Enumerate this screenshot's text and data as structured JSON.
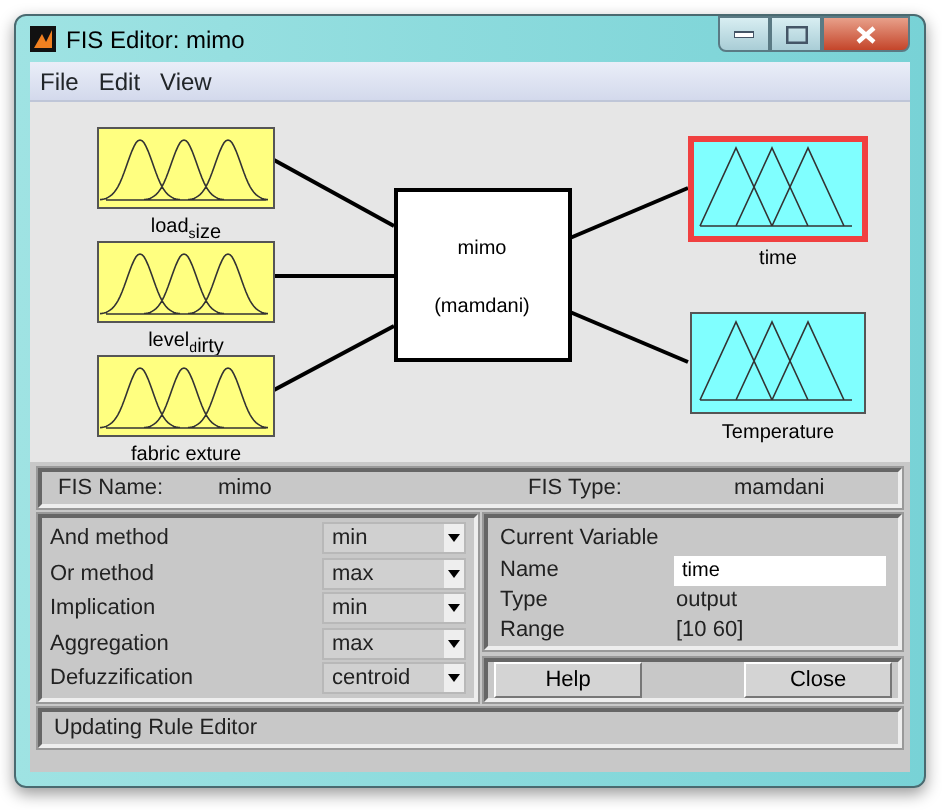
{
  "window": {
    "title": "FIS Editor: mimo"
  },
  "menu": [
    "File",
    "Edit",
    "View"
  ],
  "inputs": [
    {
      "label": "load$_{s}$ize",
      "selected": false
    },
    {
      "label": "level$_{d}$irty",
      "selected": false
    },
    {
      "label": "fabric exture",
      "selected": false
    }
  ],
  "system": {
    "name": "mimo",
    "type": "(mamdani)"
  },
  "outputs": [
    {
      "label": "time",
      "selected": true
    },
    {
      "label": "Temperature",
      "selected": false
    }
  ],
  "fis_info": {
    "name_label": "FIS Name:",
    "name": "mimo",
    "type_label": "FIS Type:",
    "type": "mamdani"
  },
  "methods": [
    {
      "label": "And method",
      "value": "min"
    },
    {
      "label": "Or method",
      "value": "max"
    },
    {
      "label": "Implication",
      "value": "min"
    },
    {
      "label": "Aggregation",
      "value": "max"
    },
    {
      "label": "Defuzzification",
      "value": "centroid"
    }
  ],
  "current_variable": {
    "title": "Current Variable",
    "name_label": "Name",
    "name": "time",
    "type_label": "Type",
    "type": "output",
    "range_label": "Range",
    "range": "[10 60]"
  },
  "buttons": [
    "Help",
    "Close"
  ],
  "status": "Updating Rule Editor"
}
